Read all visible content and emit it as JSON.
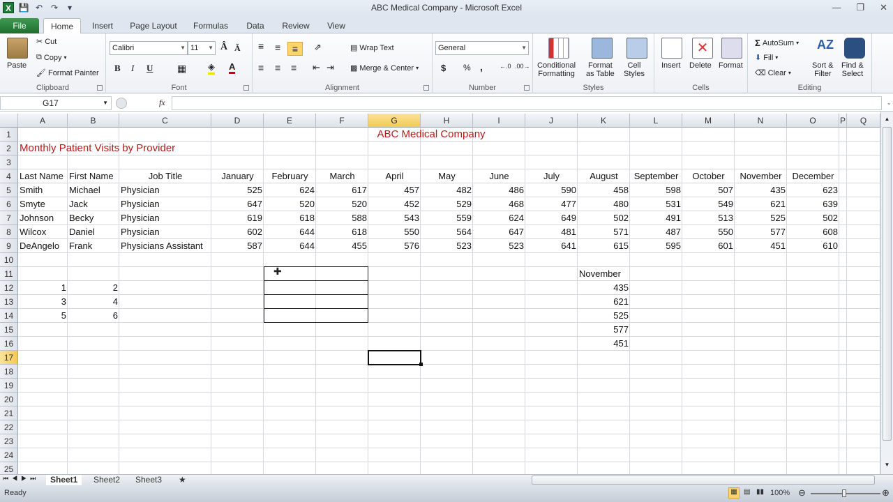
{
  "window": {
    "title": "ABC Medical Company  -  Microsoft Excel"
  },
  "qat": {
    "icons": [
      "excel-logo",
      "save-icon",
      "undo-icon",
      "redo-icon",
      "customize-icon"
    ]
  },
  "tabs": [
    {
      "label": "File"
    },
    {
      "label": "Home"
    },
    {
      "label": "Insert"
    },
    {
      "label": "Page Layout"
    },
    {
      "label": "Formulas"
    },
    {
      "label": "Data"
    },
    {
      "label": "Review"
    },
    {
      "label": "View"
    }
  ],
  "ribbon": {
    "clipboard": {
      "label": "Clipboard",
      "paste": "Paste",
      "cut": "Cut",
      "copy": "Copy",
      "format_painter": "Format Painter"
    },
    "font": {
      "label": "Font",
      "font_name": "Calibri",
      "font_size": "11",
      "bold": "B",
      "italic": "I",
      "underline": "U"
    },
    "alignment": {
      "label": "Alignment",
      "wrap_text": "Wrap Text",
      "merge_center": "Merge & Center"
    },
    "number": {
      "label": "Number",
      "format": "General",
      "currency": "$",
      "percent": "%",
      "comma": ","
    },
    "styles": {
      "label": "Styles",
      "conditional": [
        "Conditional",
        "Formatting"
      ],
      "format_table": [
        "Format",
        "as Table"
      ],
      "cell_styles": [
        "Cell",
        "Styles"
      ]
    },
    "cells": {
      "label": "Cells",
      "insert": "Insert",
      "delete": "Delete",
      "format": "Format"
    },
    "editing": {
      "label": "Editing",
      "autosum": "AutoSum",
      "fill": "Fill",
      "clear": "Clear",
      "sort": [
        "Sort &",
        "Filter"
      ],
      "find": [
        "Find &",
        "Select"
      ]
    }
  },
  "formula_bar": {
    "name_box": "G17",
    "fx": "fx",
    "value": ""
  },
  "columns": [
    "A",
    "B",
    "C",
    "D",
    "E",
    "F",
    "G",
    "H",
    "I",
    "J",
    "K",
    "L",
    "M",
    "N",
    "O",
    "P",
    "Q"
  ],
  "selected_column": "G",
  "rows": [
    1,
    2,
    3,
    4,
    5,
    6,
    7,
    8,
    9,
    10,
    11,
    12,
    13,
    14,
    15,
    16,
    17,
    18,
    19,
    20,
    21,
    22,
    23,
    24,
    25
  ],
  "selected_row": 17,
  "sheet": {
    "company_title": "ABC Medical Company",
    "subtitle": "Monthly Patient Visits by Provider",
    "headers": [
      "Last Name",
      "First Name",
      "Job Title",
      "January",
      "February",
      "March",
      "April",
      "May",
      "June",
      "July",
      "August",
      "September",
      "October",
      "November",
      "December"
    ],
    "providers": [
      {
        "last": "Smith",
        "first": "Michael",
        "title": "Physician",
        "values": [
          525,
          624,
          617,
          457,
          482,
          486,
          590,
          458,
          598,
          507,
          435,
          623
        ]
      },
      {
        "last": "Smyte",
        "first": "Jack",
        "title": "Physician",
        "values": [
          647,
          520,
          520,
          452,
          529,
          468,
          477,
          480,
          531,
          549,
          621,
          639
        ]
      },
      {
        "last": "Johnson",
        "first": "Becky",
        "title": "Physician",
        "values": [
          619,
          618,
          588,
          543,
          559,
          624,
          649,
          502,
          491,
          513,
          525,
          502
        ]
      },
      {
        "last": "Wilcox",
        "first": "Daniel",
        "title": "Physician",
        "values": [
          602,
          644,
          618,
          550,
          564,
          647,
          481,
          571,
          487,
          550,
          577,
          608
        ]
      },
      {
        "last": "DeAngelo",
        "first": "Frank",
        "title": "Physicians Assistant",
        "values": [
          587,
          644,
          455,
          576,
          523,
          523,
          641,
          615,
          595,
          601,
          451,
          610
        ]
      }
    ],
    "small_table": [
      [
        1,
        2
      ],
      [
        3,
        4
      ],
      [
        5,
        6
      ]
    ],
    "november_copy": {
      "header": "November",
      "values": [
        435,
        621,
        525,
        577,
        451
      ]
    }
  },
  "sheet_tabs": [
    "Sheet1",
    "Sheet2",
    "Sheet3"
  ],
  "active_sheet": "Sheet1",
  "status": {
    "ready": "Ready",
    "zoom": "100%"
  }
}
